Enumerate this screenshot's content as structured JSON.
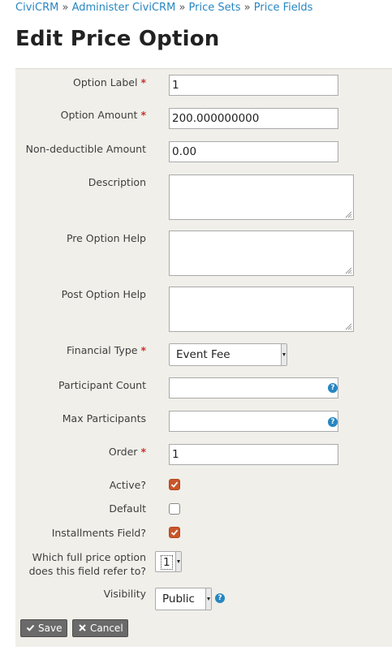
{
  "breadcrumb": {
    "items": [
      "CiviCRM",
      "Administer CiviCRM",
      "Price Sets",
      "Price Fields"
    ],
    "separator": "»"
  },
  "page_title": "Edit Price Option",
  "form": {
    "option_label": {
      "label": "Option Label",
      "value": "1",
      "required": "*"
    },
    "option_amount": {
      "label": "Option Amount",
      "value": "200.000000000",
      "required": "*"
    },
    "non_deductible": {
      "label": "Non-deductible Amount",
      "value": "0.00"
    },
    "description": {
      "label": "Description",
      "value": ""
    },
    "pre_option_help": {
      "label": "Pre Option Help",
      "value": ""
    },
    "post_option_help": {
      "label": "Post Option Help",
      "value": ""
    },
    "financial_type": {
      "label": "Financial Type",
      "selected": "Event Fee",
      "required": "*"
    },
    "participant_count": {
      "label": "Participant Count",
      "value": ""
    },
    "max_participants": {
      "label": "Max Participants",
      "value": ""
    },
    "order": {
      "label": "Order",
      "value": "1",
      "required": "*"
    },
    "active": {
      "label": "Active?",
      "checked": true
    },
    "default": {
      "label": "Default",
      "checked": false
    },
    "installments_field": {
      "label": "Installments Field?",
      "checked": true
    },
    "full_price_option": {
      "label_line1": "Which full price option",
      "label_line2": "does this field refer to?",
      "selected": "1"
    },
    "visibility": {
      "label": "Visibility",
      "selected": "Public"
    }
  },
  "buttons": {
    "save": "Save",
    "cancel": "Cancel"
  },
  "icons": {
    "help": "help-icon",
    "check": "check-icon",
    "close": "close-icon"
  },
  "colors": {
    "link": "#2786c2",
    "required": "#c9302c",
    "checkbox_checked": "#c9562a",
    "panel": "#f0efe9",
    "button": "#6a6a6a"
  }
}
